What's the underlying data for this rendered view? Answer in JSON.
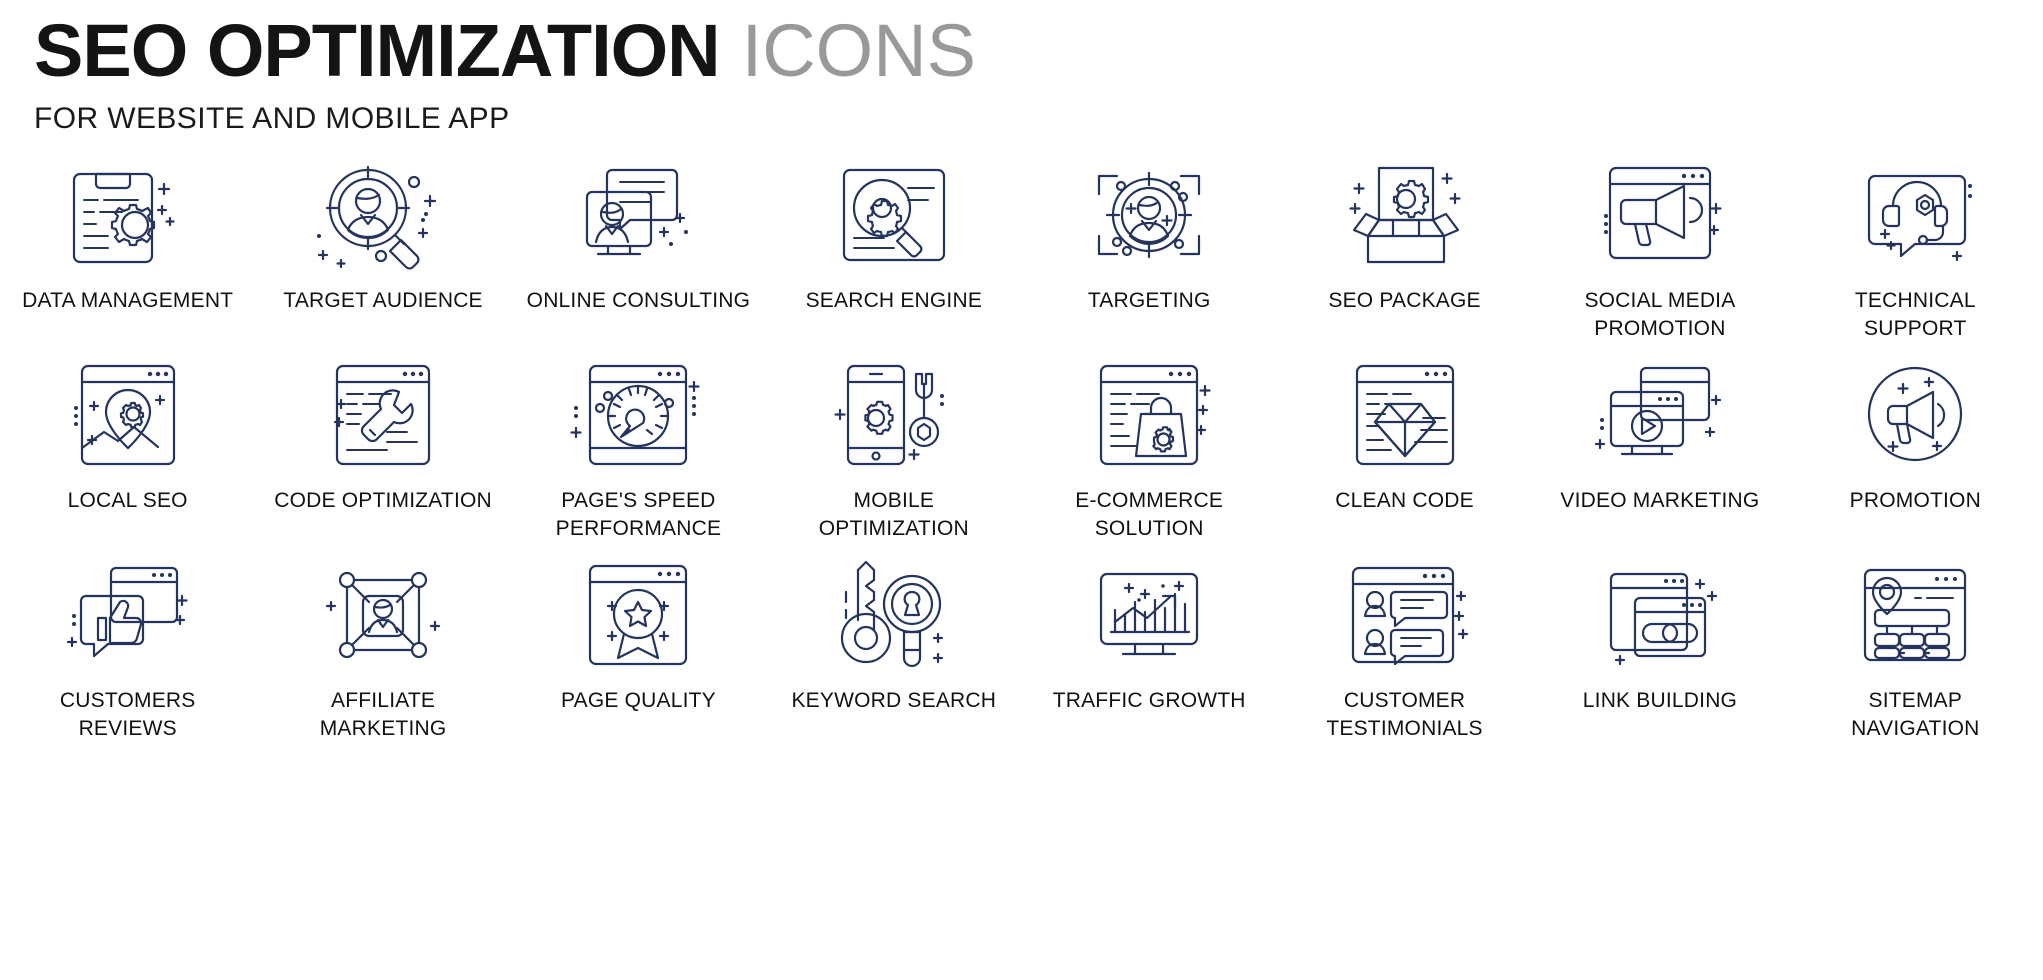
{
  "header": {
    "title_bold": "SEO OPTIMIZATION",
    "title_light": "ICONS",
    "subtitle": "FOR WEBSITE AND MOBILE APP"
  },
  "theme": {
    "icon_stroke": "#24345c",
    "title_color": "#141414",
    "title_light_color": "#999999",
    "label_color": "#111111",
    "background": "#ffffff"
  },
  "grid": {
    "columns": 8,
    "rows": 3,
    "total_icons": 24
  },
  "icons": [
    {
      "label": "DATA MANAGEMENT",
      "icon": "document-gear-icon"
    },
    {
      "label": "TARGET AUDIENCE",
      "icon": "magnifier-user-icon"
    },
    {
      "label": "ONLINE CONSULTING",
      "icon": "monitor-consultant-icon"
    },
    {
      "label": "SEARCH ENGINE",
      "icon": "magnifier-gear-page-icon"
    },
    {
      "label": "TARGETING",
      "icon": "crosshair-user-icon"
    },
    {
      "label": "SEO PACKAGE",
      "icon": "open-box-gear-icon"
    },
    {
      "label": "SOCIAL MEDIA\nPROMOTION",
      "icon": "browser-megaphone-icon"
    },
    {
      "label": "TECHNICAL\nSUPPORT",
      "icon": "headset-support-icon"
    },
    {
      "label": "LOCAL SEO",
      "icon": "map-pin-gear-icon"
    },
    {
      "label": "CODE OPTIMIZATION",
      "icon": "browser-wrench-icon"
    },
    {
      "label": "PAGE'S SPEED\nPERFORMANCE",
      "icon": "browser-speedometer-icon"
    },
    {
      "label": "MOBILE OPTIMIZATION",
      "icon": "phone-gear-wrench-icon"
    },
    {
      "label": "E-COMMERCE\nSOLUTION",
      "icon": "browser-shopping-bag-gear-icon"
    },
    {
      "label": "CLEAN CODE",
      "icon": "browser-diamond-icon"
    },
    {
      "label": "VIDEO MARKETING",
      "icon": "monitor-play-icon"
    },
    {
      "label": "PROMOTION",
      "icon": "circle-megaphone-icon"
    },
    {
      "label": "CUSTOMERS REVIEWS",
      "icon": "thumbs-up-chat-icon"
    },
    {
      "label": "AFFILIATE\nMARKETING",
      "icon": "network-user-icon"
    },
    {
      "label": "PAGE QUALITY",
      "icon": "browser-star-badge-icon"
    },
    {
      "label": "KEYWORD SEARCH",
      "icon": "key-magnifier-icon"
    },
    {
      "label": "TRAFFIC GROWTH",
      "icon": "monitor-growth-chart-icon"
    },
    {
      "label": "CUSTOMER\nTESTIMONIALS",
      "icon": "browser-testimonial-icon"
    },
    {
      "label": "LINK BUILDING",
      "icon": "browser-chain-link-icon"
    },
    {
      "label": "SITEMAP\nNAVIGATION",
      "icon": "browser-sitemap-pin-icon"
    }
  ]
}
